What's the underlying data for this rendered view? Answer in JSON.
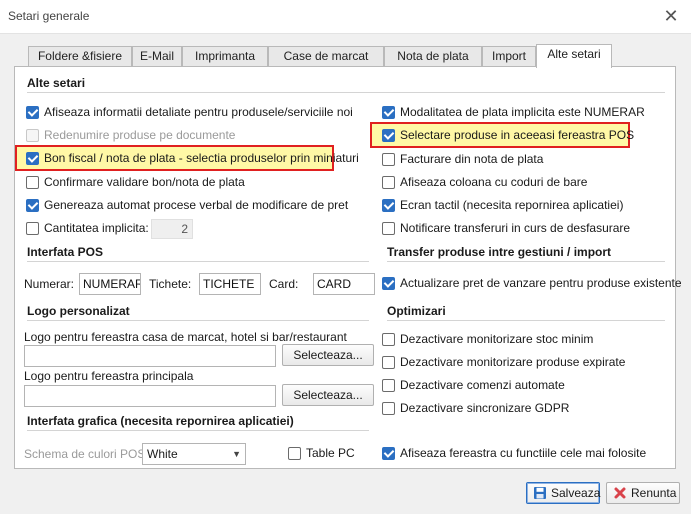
{
  "window": {
    "title": "Setari generale",
    "close_icon": "close-icon"
  },
  "tabs": [
    {
      "label": "Foldere &fisiere"
    },
    {
      "label": "E-Mail"
    },
    {
      "label": "Imprimanta"
    },
    {
      "label": "Case de marcat"
    },
    {
      "label": "Nota de plata"
    },
    {
      "label": "Import"
    },
    {
      "label": "Alte setari",
      "active": true
    }
  ],
  "sections": {
    "alte_setari": "Alte setari",
    "interfata_pos": "Interfata POS",
    "transfer": "Transfer produse intre gestiuni / import",
    "logo": "Logo personalizat",
    "optimizari": "Optimizari",
    "interfata_grafica": "Interfata grafica (necesita repornirea aplicatiei)"
  },
  "left_options": [
    {
      "label": "Afiseaza informatii detaliate pentru produsele/serviciile noi",
      "checked": true,
      "disabled": false
    },
    {
      "label": "Redenumire produse pe documente",
      "checked": false,
      "disabled": true
    },
    {
      "label": "Bon fiscal / nota de plata - selectia produselor prin miniaturi",
      "checked": true,
      "disabled": false,
      "highlighted": true
    },
    {
      "label": "Confirmare validare bon/nota de plata",
      "checked": false,
      "disabled": false
    },
    {
      "label": "Genereaza automat procese verbal de modificare de pret",
      "checked": true,
      "disabled": false
    },
    {
      "label": "Cantitatea implicita:",
      "checked": false,
      "disabled": false
    }
  ],
  "cantitate_implicita": "2",
  "right_options": [
    {
      "label": "Modalitatea de plata implicita este NUMERAR",
      "checked": true,
      "disabled": false
    },
    {
      "label": "Selectare produse in aceeasi fereastra POS",
      "checked": true,
      "disabled": false,
      "highlighted": true
    },
    {
      "label": "Facturare din nota de plata",
      "checked": false,
      "disabled": false
    },
    {
      "label": "Afiseaza coloana cu coduri de bare",
      "checked": false,
      "disabled": false
    },
    {
      "label": "Ecran tactil (necesita repornirea aplicatiei)",
      "checked": true,
      "disabled": false
    },
    {
      "label": "Notificare transferuri in curs de desfasurare",
      "checked": false,
      "disabled": false
    }
  ],
  "pos": {
    "numerar_label": "Numerar:",
    "numerar_value": "NUMERAR",
    "tichete_label": "Tichete:",
    "tichete_value": "TICHETE",
    "card_label": "Card:",
    "card_value": "CARD"
  },
  "transfer_option": {
    "label": "Actualizare pret de vanzare pentru produse existente",
    "checked": true
  },
  "logo": {
    "casa_label": "Logo pentru fereastra casa de marcat, hotel si bar/restaurant",
    "casa_value": "",
    "principala_label": "Logo pentru fereastra principala",
    "principala_value": "",
    "select_btn": "Selecteaza..."
  },
  "optimizari": [
    {
      "label": "Dezactivare monitorizare stoc minim",
      "checked": false
    },
    {
      "label": "Dezactivare monitorizare produse expirate",
      "checked": false
    },
    {
      "label": "Dezactivare comenzi automate",
      "checked": false
    },
    {
      "label": "Dezactivare sincronizare GDPR",
      "checked": false
    }
  ],
  "grafica": {
    "schema_label": "Schema de culori POS:",
    "schema_value": "White",
    "table_pc_label": "Table PC",
    "table_pc_checked": false,
    "fereastra_label": "Afiseaza fereastra cu functiile cele mai folosite",
    "fereastra_checked": true
  },
  "footer": {
    "save": "Salveaza",
    "cancel": "Renunta"
  },
  "colors": {
    "accent": "#2b6fc2",
    "highlight_border": "#e02020",
    "highlight_fill": "#fff8a6"
  }
}
